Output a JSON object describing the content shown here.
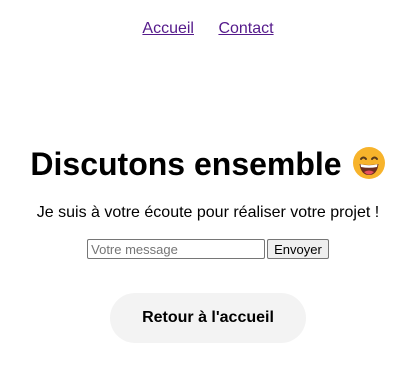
{
  "nav": {
    "home_label": "Accueil",
    "contact_label": "Contact"
  },
  "main": {
    "title": "Discutons ensemble",
    "title_emoji": "grinning-face-emoji",
    "subtitle": "Je suis à votre écoute pour réaliser votre projet !"
  },
  "form": {
    "message_value": "",
    "message_placeholder": "Votre message",
    "submit_label": "Envoyer"
  },
  "back_button": {
    "label": "Retour à l'accueil"
  },
  "colors": {
    "link": "#551a8b",
    "button_bg": "#efefef",
    "back_bg": "#f3f3f3",
    "emoji_face": "#f7b32b"
  }
}
